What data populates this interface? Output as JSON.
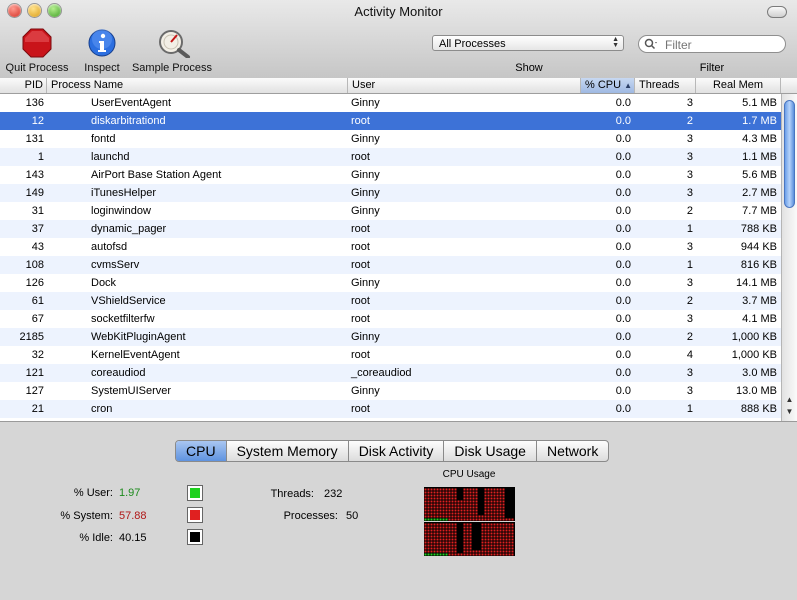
{
  "window": {
    "title": "Activity Monitor"
  },
  "toolbar": {
    "quit_label": "Quit Process",
    "inspect_label": "Inspect",
    "sample_label": "Sample Process",
    "show_select": "All Processes",
    "show_label": "Show",
    "filter_placeholder": "Filter",
    "filter_label": "Filter"
  },
  "table": {
    "columns": {
      "pid": "PID",
      "name": "Process Name",
      "user": "User",
      "cpu": "% CPU",
      "threads": "Threads",
      "mem": "Real Mem"
    },
    "sorted_column": "% CPU",
    "selected_pid": "12",
    "rows": [
      {
        "pid": "136",
        "name": "UserEventAgent",
        "user": "Ginny",
        "cpu": "0.0",
        "threads": "3",
        "mem": "5.1 MB"
      },
      {
        "pid": "12",
        "name": "diskarbitrationd",
        "user": "root",
        "cpu": "0.0",
        "threads": "2",
        "mem": "1.7 MB"
      },
      {
        "pid": "131",
        "name": "fontd",
        "user": "Ginny",
        "cpu": "0.0",
        "threads": "3",
        "mem": "4.3 MB"
      },
      {
        "pid": "1",
        "name": "launchd",
        "user": "root",
        "cpu": "0.0",
        "threads": "3",
        "mem": "1.1 MB"
      },
      {
        "pid": "143",
        "name": "AirPort Base Station Agent",
        "user": "Ginny",
        "cpu": "0.0",
        "threads": "3",
        "mem": "5.6 MB"
      },
      {
        "pid": "149",
        "name": "iTunesHelper",
        "user": "Ginny",
        "cpu": "0.0",
        "threads": "3",
        "mem": "2.7 MB"
      },
      {
        "pid": "31",
        "name": "loginwindow",
        "user": "Ginny",
        "cpu": "0.0",
        "threads": "2",
        "mem": "7.7 MB"
      },
      {
        "pid": "37",
        "name": "dynamic_pager",
        "user": "root",
        "cpu": "0.0",
        "threads": "1",
        "mem": "788 KB"
      },
      {
        "pid": "43",
        "name": "autofsd",
        "user": "root",
        "cpu": "0.0",
        "threads": "3",
        "mem": "944 KB"
      },
      {
        "pid": "108",
        "name": "cvmsServ",
        "user": "root",
        "cpu": "0.0",
        "threads": "1",
        "mem": "816 KB"
      },
      {
        "pid": "126",
        "name": "Dock",
        "user": "Ginny",
        "cpu": "0.0",
        "threads": "3",
        "mem": "14.1 MB"
      },
      {
        "pid": "61",
        "name": "VShieldService",
        "user": "root",
        "cpu": "0.0",
        "threads": "2",
        "mem": "3.7 MB"
      },
      {
        "pid": "67",
        "name": "socketfilterfw",
        "user": "root",
        "cpu": "0.0",
        "threads": "3",
        "mem": "4.1 MB"
      },
      {
        "pid": "2185",
        "name": "WebKitPluginAgent",
        "user": "Ginny",
        "cpu": "0.0",
        "threads": "2",
        "mem": "1,000 KB"
      },
      {
        "pid": "32",
        "name": "KernelEventAgent",
        "user": "root",
        "cpu": "0.0",
        "threads": "4",
        "mem": "1,000 KB"
      },
      {
        "pid": "121",
        "name": "coreaudiod",
        "user": "_coreaudiod",
        "cpu": "0.0",
        "threads": "3",
        "mem": "3.0 MB"
      },
      {
        "pid": "127",
        "name": "SystemUIServer",
        "user": "Ginny",
        "cpu": "0.0",
        "threads": "3",
        "mem": "13.0 MB"
      },
      {
        "pid": "21",
        "name": "cron",
        "user": "root",
        "cpu": "0.0",
        "threads": "1",
        "mem": "888 KB"
      }
    ]
  },
  "tabs": [
    "CPU",
    "System Memory",
    "Disk Activity",
    "Disk Usage",
    "Network"
  ],
  "active_tab": "CPU",
  "cpu": {
    "user_label": "% User:",
    "user_value": "1.97",
    "system_label": "% System:",
    "system_value": "57.88",
    "idle_label": "% Idle:",
    "idle_value": "40.15",
    "threads_label": "Threads:",
    "threads_value": "232",
    "processes_label": "Processes:",
    "processes_value": "50",
    "graph_title": "CPU Usage",
    "colors": {
      "user": "#1fd11f",
      "system": "#e02020",
      "idle": "#000000",
      "user_text": "#1c8a1c",
      "system_text": "#b01818"
    }
  },
  "icons": {
    "quit": "stop-sign-icon",
    "inspect": "info-icon",
    "sample": "sample-process-icon",
    "search": "magnifier-icon"
  }
}
